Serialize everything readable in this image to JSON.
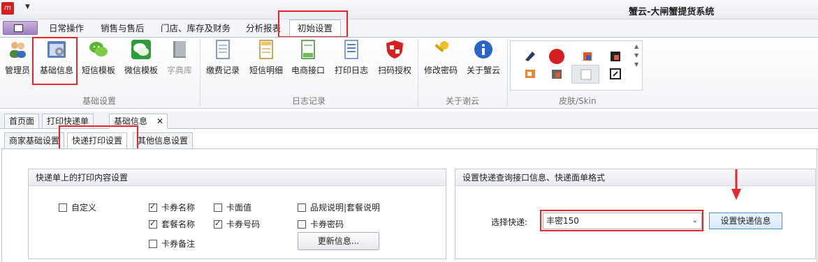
{
  "app": {
    "title": "蟹云-大闸蟹提货系统",
    "logo_text": "m"
  },
  "menu_tabs": [
    {
      "label": "日常操作"
    },
    {
      "label": "销售与售后"
    },
    {
      "label": "门店、库存及财务"
    },
    {
      "label": "分析报表"
    },
    {
      "label": "初始设置"
    }
  ],
  "ribbon": {
    "groups": [
      {
        "label": "基础设置",
        "items": [
          {
            "label": "管理员"
          },
          {
            "label": "基础信息"
          },
          {
            "label": "短信模板"
          },
          {
            "label": "微信模板"
          },
          {
            "label": "字典库"
          }
        ]
      },
      {
        "label": "日志记录",
        "items": [
          {
            "label": "缴费记录"
          },
          {
            "label": "短信明细"
          },
          {
            "label": "电商接口"
          },
          {
            "label": "打印日志"
          },
          {
            "label": "扫码授权"
          }
        ]
      },
      {
        "label": "关于谢云",
        "items": [
          {
            "label": "修改密码"
          },
          {
            "label": "关于蟹云"
          }
        ]
      },
      {
        "label": "皮肤/Skin",
        "items": []
      }
    ]
  },
  "doc_tabs": [
    {
      "label": "首页面"
    },
    {
      "label": "打印快递单"
    },
    {
      "label": "基础信息"
    }
  ],
  "sub_tabs": [
    {
      "label": "商家基础设置"
    },
    {
      "label": "快递打印设置"
    },
    {
      "label": "其他信息设置"
    }
  ],
  "print_panel": {
    "title": "快递单上的打印内容设置",
    "checkboxes": [
      {
        "label": "自定义",
        "checked": false
      },
      {
        "label": "卡券名称",
        "checked": true
      },
      {
        "label": "卡面值",
        "checked": false
      },
      {
        "label": "品规说明|套餐说明",
        "checked": false
      },
      {
        "label": "套餐名称",
        "checked": true
      },
      {
        "label": "卡券号码",
        "checked": true
      },
      {
        "label": "卡券密码",
        "checked": false
      },
      {
        "label": "卡券备注",
        "checked": false
      }
    ],
    "update_button": "更新信息..."
  },
  "express_panel": {
    "title": "设置快递查询接口信息、快递面单格式",
    "select_label": "选择快递:",
    "select_value": "丰密150",
    "button": "设置快递信息"
  },
  "colors": {
    "highlight": "#e8262b",
    "accent": "#4a90d9"
  }
}
